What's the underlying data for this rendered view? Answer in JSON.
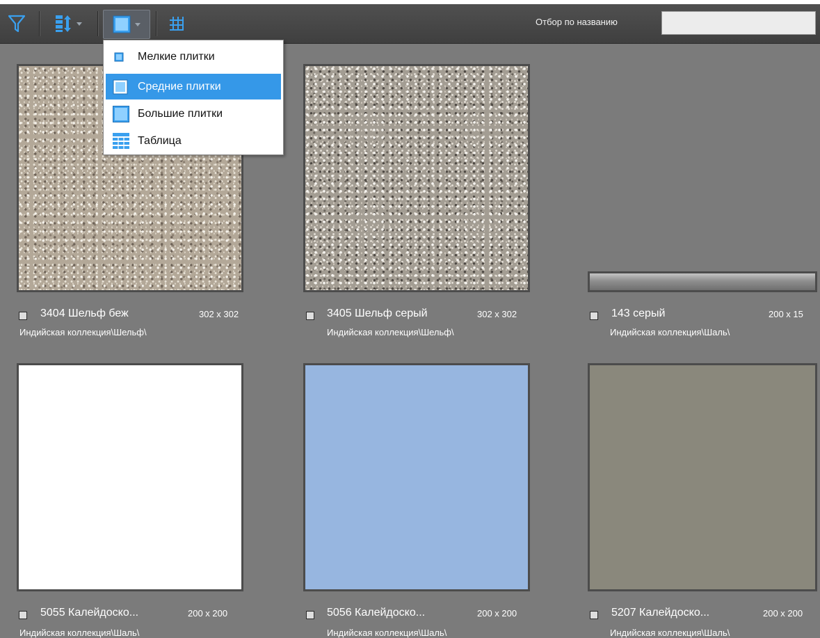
{
  "toolbar": {
    "filter_label": "Отбор по названию",
    "filter_value": "",
    "icons": [
      "filter-icon",
      "sort-icon",
      "view-mode-icon",
      "grid-icon"
    ]
  },
  "view_menu": {
    "items": [
      {
        "label": "Мелкие плитки",
        "icon": "small-tiles-icon",
        "selected": false
      },
      {
        "label": "Средние плитки",
        "icon": "medium-tiles-icon",
        "selected": true
      },
      {
        "label": "Большие плитки",
        "icon": "large-tiles-icon",
        "selected": false
      },
      {
        "label": "Таблица",
        "icon": "table-icon",
        "selected": false
      }
    ]
  },
  "tiles": [
    {
      "name": "3404 Шельф беж",
      "size": "302 x 302",
      "collection": "Индийская коллекция\\Шельф\\",
      "swatch": "stone-beige"
    },
    {
      "name": "3405 Шельф серый",
      "size": "302 x 302",
      "collection": "Индийская коллекция\\Шельф\\",
      "swatch": "stone-grey"
    },
    {
      "name": "143 серый",
      "size": "200 x 15",
      "collection": "Индийская коллекция\\Шаль\\",
      "swatch": "border-strip"
    },
    {
      "name": "5055 Калейдоско...",
      "size": "200 x 200",
      "collection": "Индийская коллекция\\Шаль\\",
      "color": "#ffffff"
    },
    {
      "name": "5056 Калейдоско...",
      "size": "200 x 200",
      "collection": "Индийская коллекция\\Шаль\\",
      "color": "#97b6e0"
    },
    {
      "name": "5207 Калейдоско...",
      "size": "200 x 200",
      "collection": "Индийская коллекция\\Шаль\\",
      "color": "#8a887c"
    }
  ],
  "colors": {
    "background": "#7b7b7b",
    "toolbar": "#454545",
    "menu_highlight": "#3598e8",
    "icon_blue": "#3aa0ef"
  }
}
